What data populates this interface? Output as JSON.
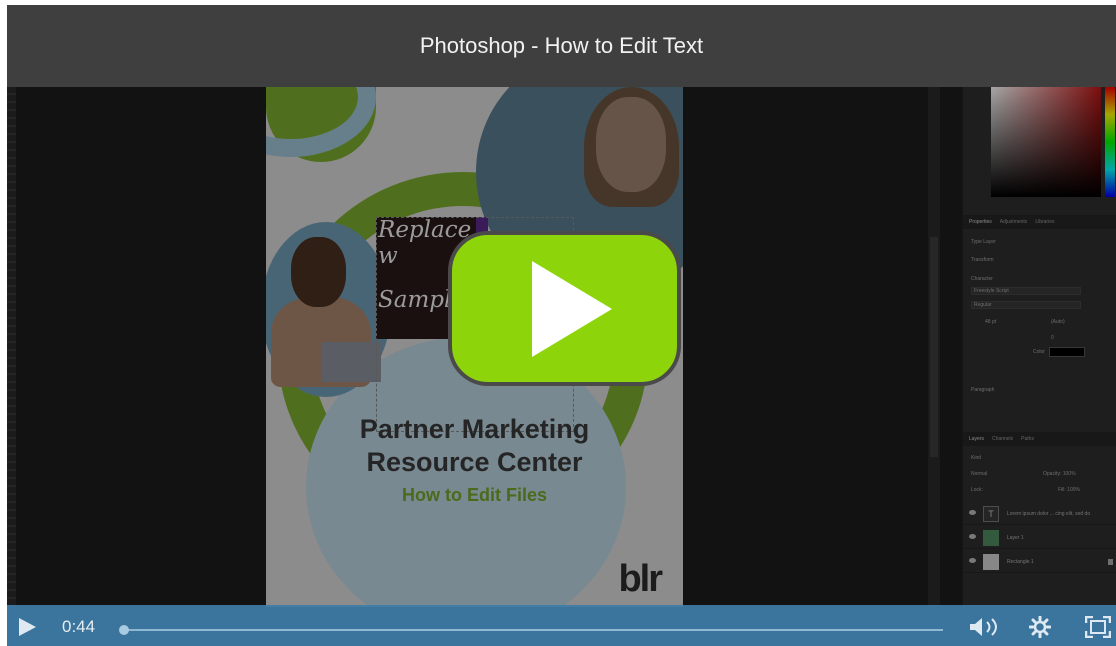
{
  "title": "Photoshop - How to Edit Text",
  "poster": {
    "text_line_1": "Replace w",
    "text_line_2": "Sample",
    "headline_1": "Partner Marketing",
    "headline_2": "Resource Center",
    "subhead": "How to Edit Files",
    "brand": "blr"
  },
  "panels": {
    "properties_tabs": [
      "Properties",
      "Adjustments",
      "Libraries"
    ],
    "type_layer": "Type Layer",
    "transform": "Transform",
    "character": "Character",
    "font": "Freestyle Script",
    "style": "Regular",
    "size": "48 pt",
    "leading": "(Auto)",
    "tracking": "0",
    "color_label": "Color",
    "paragraph": "Paragraph",
    "layers_tabs": [
      "Layers",
      "Channels",
      "Paths"
    ],
    "kind": "Kind",
    "blend": "Normal",
    "opacity": "Opacity: 100%",
    "lock": "Lock:",
    "fill": "Fill: 100%",
    "layers": [
      {
        "name": "Lorem ipsum dolor ... cing elit, sed do",
        "type": "text"
      },
      {
        "name": "Layer 1",
        "type": "img"
      },
      {
        "name": "Rectangle 1",
        "type": "shape"
      }
    ]
  },
  "controls": {
    "time": "0:44",
    "progress": 0.0
  },
  "colors": {
    "play_button": "#8dd40a",
    "control_bar": "#3e7ca8",
    "title_bar": "#3f3f3f"
  }
}
